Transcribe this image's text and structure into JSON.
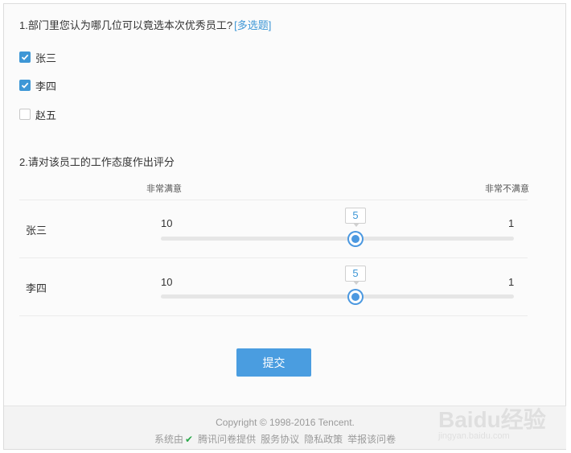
{
  "question1": {
    "title": "1.部门里您认为哪几位可以竟选本次优秀员工?",
    "tag": "[多选题]",
    "options": [
      {
        "label": "张三",
        "checked": true
      },
      {
        "label": "李四",
        "checked": true
      },
      {
        "label": "赵五",
        "checked": false
      }
    ]
  },
  "question2": {
    "title": "2.请对该员工的工作态度作出评分",
    "scale_left": "非常满意",
    "scale_right": "非常不满意",
    "rows": [
      {
        "label": "张三",
        "min_label": "10",
        "max_label": "1",
        "value": "5"
      },
      {
        "label": "李四",
        "min_label": "10",
        "max_label": "1",
        "value": "5"
      }
    ]
  },
  "submit_label": "提交",
  "footer": {
    "copyright": "Copyright © 1998-2016 Tencent.",
    "provided_prefix": "系统由",
    "provider": "腾讯问卷提供",
    "links": [
      "服务协议",
      "隐私政策",
      "举报该问卷"
    ]
  },
  "watermark": {
    "brand": "Baidu经验",
    "url": "jingyan.baidu.com"
  },
  "colors": {
    "accent": "#3e97d6",
    "button": "#4a9de0"
  }
}
